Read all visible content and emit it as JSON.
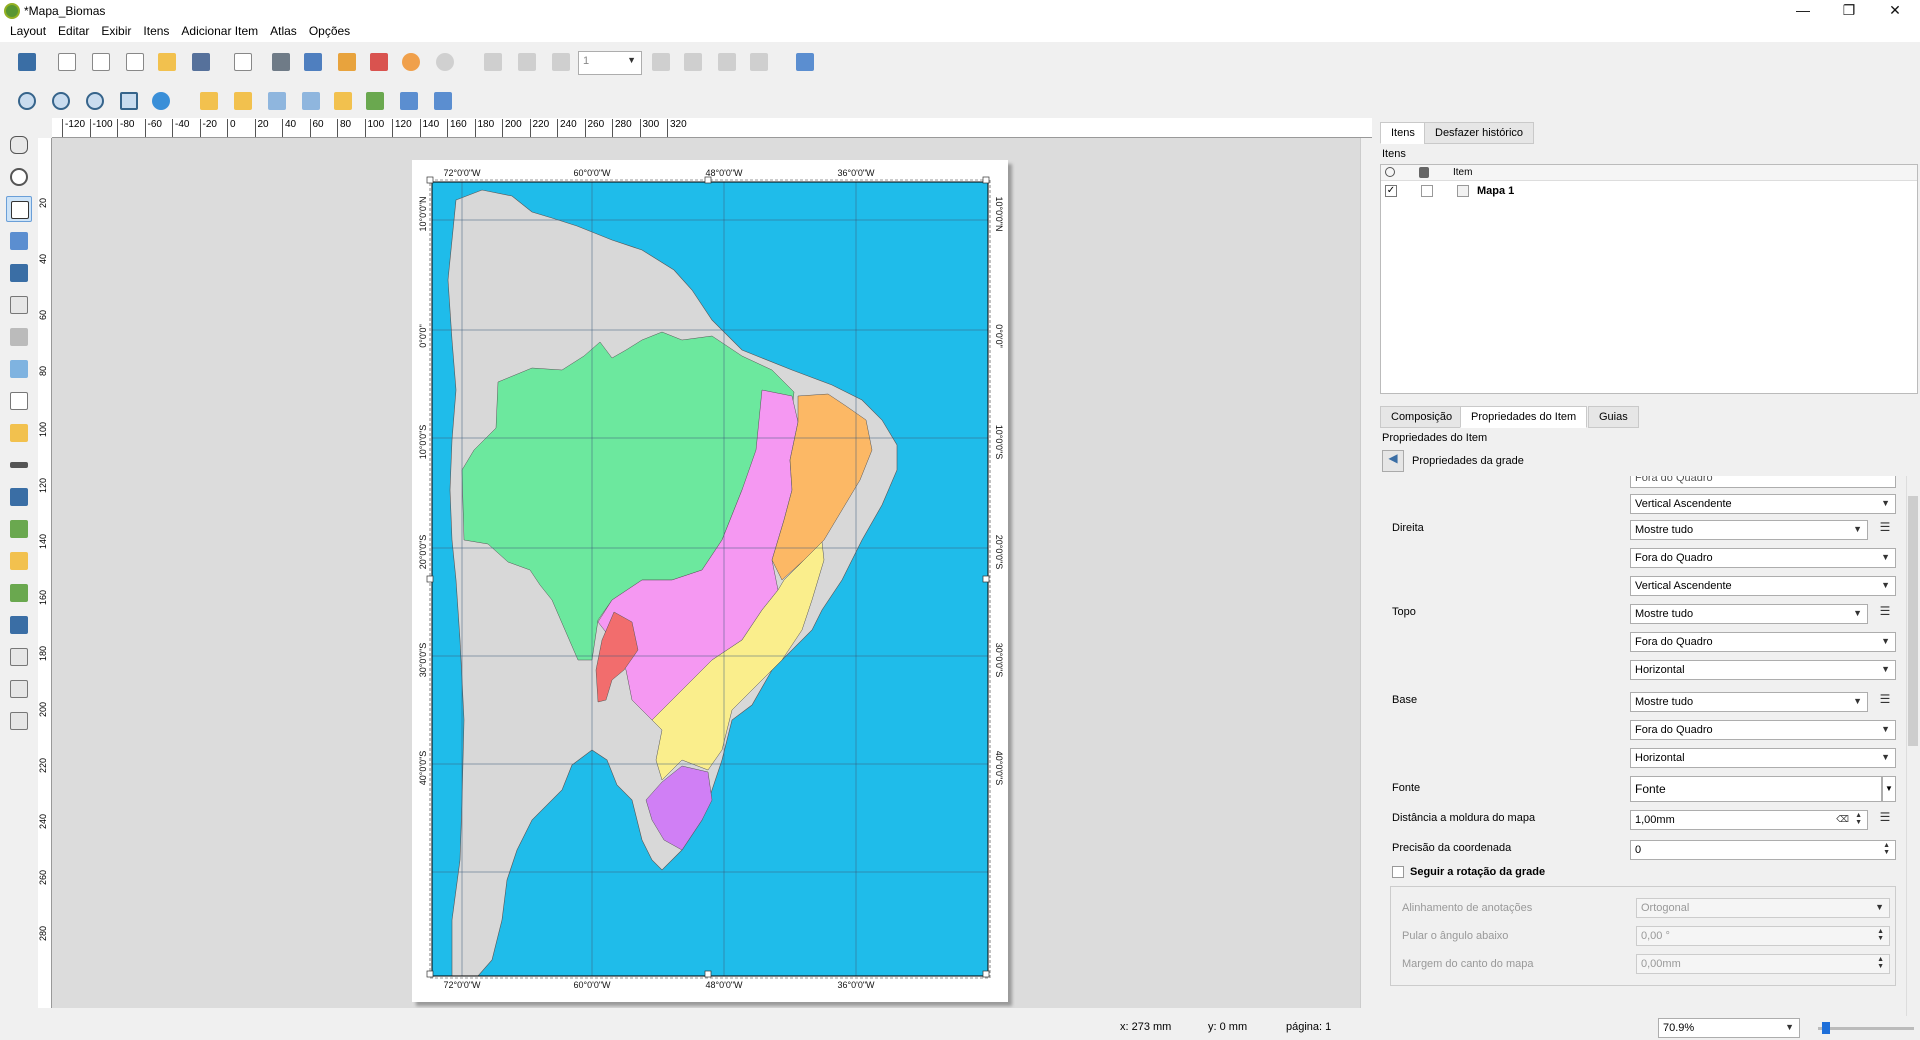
{
  "window": {
    "title": "*Mapa_Biomas",
    "minimize": "—",
    "restore": "❐",
    "close": "✕"
  },
  "menu": [
    "Layout",
    "Editar",
    "Exibir",
    "Itens",
    "Adicionar Item",
    "Atlas",
    "Opções"
  ],
  "toolbar1": {
    "page_value": "1"
  },
  "ruler_top_labels": [
    "-120",
    "-100",
    "-80",
    "-60",
    "-40",
    "-20",
    "0",
    "20",
    "40",
    "60",
    "80",
    "100",
    "120",
    "140",
    "160",
    "180",
    "200",
    "220",
    "240",
    "260",
    "280",
    "300",
    "320"
  ],
  "ruler_left_labels": [
    "20",
    "40",
    "60",
    "80",
    "100",
    "120",
    "140",
    "160",
    "180",
    "200",
    "220",
    "240",
    "260",
    "280"
  ],
  "map": {
    "top_labels": [
      "72°0'0\"W",
      "60°0'0\"W",
      "48°0'0\"W",
      "36°0'0\"W"
    ],
    "bottom_labels": [
      "72°0'0\"W",
      "60°0'0\"W",
      "48°0'0\"W",
      "36°0'0\"W"
    ],
    "left_labels": [
      "10°0'0\"N",
      "0°0'0\"",
      "10°0'0\"S",
      "20°0'0\"S",
      "30°0'0\"S",
      "40°0'0\"S"
    ],
    "right_labels": [
      "10°0'0\"N",
      "0°0'0\"",
      "10°0'0\"S",
      "20°0'0\"S",
      "30°0'0\"S",
      "40°0'0\"S"
    ],
    "colors": {
      "ocean": "#1fbcea",
      "land": "#d8d8d8",
      "amazonia": "#6ce89e",
      "cerrado": "#f598f2",
      "caatinga": "#fcb865",
      "mata_atlantica": "#faee8c",
      "pantanal": "#f26d6d",
      "pampa": "#d07ff5"
    }
  },
  "panel": {
    "tabs_top": [
      "Itens",
      "Desfazer histórico"
    ],
    "items_header": "Itens",
    "col_item": "Item",
    "item_name": "Mapa 1",
    "tabs_bottom": [
      "Composição",
      "Propriedades do Item",
      "Guias"
    ],
    "props_header": "Propriedades do Item",
    "back_label": "Propriedades da grade",
    "partial_top": "Fora do Quadro",
    "rows": {
      "r0_combo": "Vertical Ascendente",
      "direita": "Direita",
      "direita_mode": "Mostre tudo",
      "direita_pos": "Fora do Quadro",
      "direita_dir": "Vertical Ascendente",
      "topo": "Topo",
      "topo_mode": "Mostre tudo",
      "topo_pos": "Fora do Quadro",
      "topo_dir": "Horizontal",
      "base": "Base",
      "base_mode": "Mostre tudo",
      "base_pos": "Fora do Quadro",
      "base_dir": "Horizontal",
      "fonte": "Fonte",
      "fonte_btn": "Fonte",
      "distancia": "Distância a moldura do mapa",
      "distancia_val": "1,00mm",
      "precisao": "Precisão da coordenada",
      "precisao_val": "0",
      "seguir": "Seguir a rotação da grade",
      "alinhamento": "Alinhamento de anotações",
      "alinhamento_val": "Ortogonal",
      "pular": "Pular o ângulo abaixo",
      "pular_val": "0,00 °",
      "margem": "Margem do canto do mapa",
      "margem_val": "0,00mm"
    }
  },
  "status": {
    "x": "x: 273 mm",
    "y": "y: 0 mm",
    "page": "página: 1",
    "zoom": "70.9%"
  }
}
